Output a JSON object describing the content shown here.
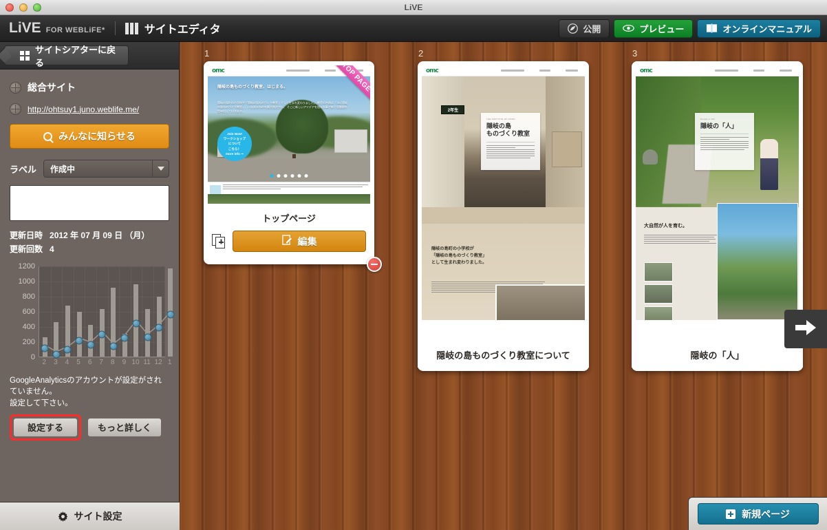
{
  "window": {
    "title": "LiVE"
  },
  "toolbar": {
    "brand_main": "LiVE",
    "brand_sub": "FOR WEBLiFE*",
    "editor_title": "サイトエディタ",
    "publish_label": "公開",
    "preview_label": "プレビュー",
    "manual_label": "オンラインマニュアル"
  },
  "sidebar": {
    "back_label": "サイトシアターに戻る",
    "site_name": "総合サイト",
    "site_url": "http://ohtsuy1.juno.weblife.me/",
    "announce_label": "みんなに知らせる",
    "label_caption": "ラベル",
    "label_value": "作成中",
    "memo_value": "",
    "updated_label": "更新日時",
    "updated_value": "2012 年 07 月 09 日 （月）",
    "count_label": "更新回数",
    "count_value": "4",
    "ga_note": "GoogleAnalyticsのアカウントが設定がされていません。\n設定して下さい。",
    "ga_configure_label": "設定する",
    "ga_more_label": "もっと詳しく",
    "site_settings_label": "サイト設定"
  },
  "chart_data": {
    "type": "bar",
    "title": "",
    "xlabel": "",
    "ylabel": "",
    "ylim": [
      0,
      1200
    ],
    "grid": true,
    "legend": "none",
    "categories": [
      "2",
      "3",
      "4",
      "5",
      "6",
      "7",
      "8",
      "9",
      "10",
      "11",
      "12",
      "1"
    ],
    "series": [
      {
        "name": "bars",
        "type": "bar",
        "values": [
          250,
          450,
          670,
          590,
          415,
          620,
          910,
          300,
          950,
          620,
          785,
          1160
        ]
      },
      {
        "name": "line",
        "type": "line",
        "values": [
          160,
          75,
          140,
          255,
          200,
          340,
          180,
          295,
          485,
          305,
          430,
          600
        ]
      }
    ],
    "yticks": [
      0,
      200,
      400,
      600,
      800,
      1000,
      1200
    ]
  },
  "pages": [
    {
      "number": "1",
      "title": "トップページ",
      "ribbon": "TOP PAGE",
      "edit_label": "編集",
      "is_top": true,
      "hero_heading": "隠岐の島ものづくり教室、はじまる。",
      "hero_body": "隠岐の島町の小学校が「隠岐の島ものづくり教室」として生まれ変わりました。\n教室の名前は「OKI 隠岐の島ものづくり教室」。いまあるものを最大限活かし、\nそこに新しいアイデアを加える事で新たな価値を生み出していきます。",
      "badge_lines": [
        "Join Now!",
        "ワークショップ",
        "について",
        "こちら！",
        "more info ⇒"
      ]
    },
    {
      "number": "2",
      "title": "隠岐の島ものづくり教室について",
      "sheet_title": "隠岐の島\nものづくり教室",
      "sheet_kicker": "THE INSTITUTE OF OKINO",
      "sign": "2年生",
      "section_heading": "隠岐の島町の小学校が\n「隠岐の島ものづくり教室」\nとして生まれ変わりました。"
    },
    {
      "number": "3",
      "title": "隠岐の「人」",
      "sheet_title": "隠岐の「人」",
      "sheet_kicker": "People in OKI",
      "section_heading": "大自然が人を育む。"
    }
  ],
  "nav": {
    "next_label": "next-page"
  },
  "footer": {
    "new_page_label": "新規ページ"
  },
  "colors": {
    "accent_orange": "#e08b14",
    "accent_green": "#18922e",
    "accent_blue": "#15708f",
    "ribbon_pink": "#e049a8",
    "highlight_red": "#ff2a2a",
    "chart_bar": "#a09a94",
    "chart_dot": "#4f86a4"
  }
}
